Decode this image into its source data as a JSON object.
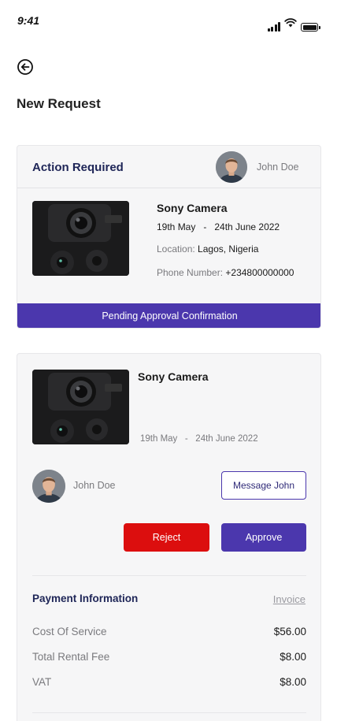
{
  "status_bar": {
    "time": "9:41"
  },
  "header": {
    "title": "New Request"
  },
  "action_card": {
    "title": "Action Required",
    "user_name": "John Doe",
    "product_name": "Sony Camera",
    "dates": "19th May   -   24th June 2022",
    "location_label": "Location:",
    "location_value": "Lagos, Nigeria",
    "phone_label": "Phone Number:",
    "phone_value": "+234800000000",
    "status": "Pending Approval Confirmation"
  },
  "request_card": {
    "product_name": "Sony Camera",
    "dates": "19th May   -   24th June 2022",
    "owner_name": "John Doe",
    "message_button": "Message John",
    "reject_button": "Reject",
    "approve_button": "Approve",
    "payment": {
      "title": "Payment Information",
      "invoice_link": "Invoice",
      "rows": [
        {
          "label": "Cost Of Service",
          "value": "$56.00"
        },
        {
          "label": "Total Rental Fee",
          "value": "$8.00"
        },
        {
          "label": "VAT",
          "value": "$8.00"
        }
      ]
    }
  },
  "colors": {
    "primary": "#4b37ad",
    "danger": "#dc0e0e",
    "heading": "#1e2557",
    "muted": "#7a7a7e"
  },
  "icons": {
    "back": "back-arrow-circle-icon",
    "signal": "signal-icon",
    "wifi": "wifi-icon",
    "battery": "battery-icon"
  }
}
